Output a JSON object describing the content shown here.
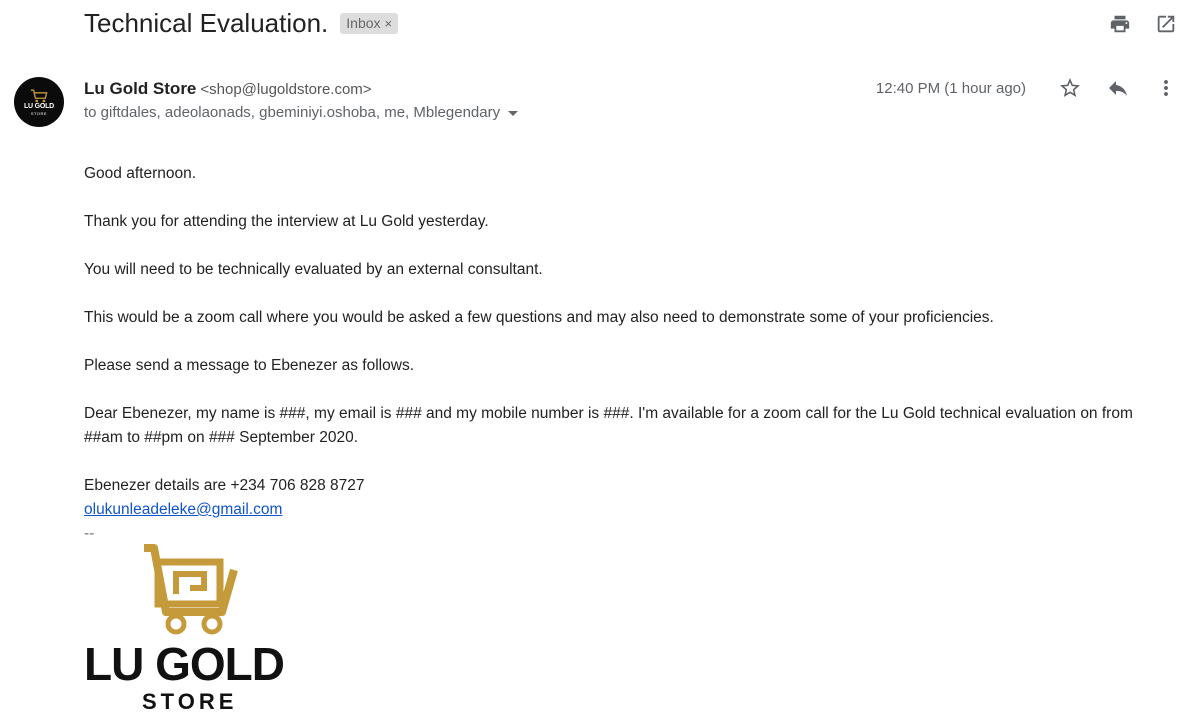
{
  "email": {
    "subject": "Technical Evaluation.",
    "label": "Inbox",
    "label_close": "×",
    "sender_name": "Lu Gold Store",
    "sender_email": "<shop@lugoldstore.com>",
    "recipients": "to giftdales, adeolaonads, gbeminiyi.oshoba, me, Mblegendary",
    "timestamp": "12:40 PM (1 hour ago)"
  },
  "avatar": {
    "line1": "LU GOLD",
    "line2": "STORE"
  },
  "icons": {
    "print": "print-icon",
    "open_new_window": "open-in-new-window-icon",
    "star": "star-icon",
    "reply": "reply-icon",
    "more": "more-vertical-icon"
  },
  "body": {
    "greeting": "Good afternoon.",
    "p1": "Thank you for attending the interview at Lu Gold yesterday.",
    "p2": "You will need to be technically evaluated by an external consultant.",
    "p3": "This would be a zoom call where you would be asked a few questions and may also need to demonstrate some of your proficiencies.",
    "p4": "Please send a message to Ebenezer as follows.",
    "p5": "Dear Ebenezer, my name is ###, my email is ### and my mobile number is ###. I'm available for a zoom call for the Lu Gold technical evaluation on from ##am to ##pm on ### September 2020.",
    "contact": "Ebenezer details are +234 706 828 8727",
    "contact_email": "olukunleadeleke@gmail.com",
    "sig_separator": "--"
  },
  "signature_logo": {
    "line1": "LU GOLD",
    "line2": "STORE"
  },
  "colors": {
    "gold": "#c49a3a",
    "link": "#1155cc",
    "chip_bg": "#dddddd"
  }
}
